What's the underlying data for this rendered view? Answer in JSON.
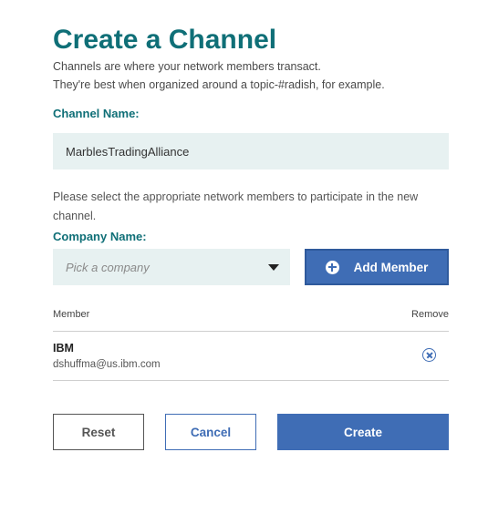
{
  "page": {
    "title": "Create a Channel",
    "subtitle_line1": "Channels are where your network members transact.",
    "subtitle_line2": "They're best when organized around a topic-#radish, for example."
  },
  "channel": {
    "label": "Channel Name:",
    "value": "MarblesTradingAlliance"
  },
  "members_help": "Please select the appropriate network members to participate in the new channel.",
  "company": {
    "label": "Company Name:",
    "placeholder": "Pick a company",
    "add_button_label": "Add Member"
  },
  "members_table": {
    "col_member": "Member",
    "col_remove": "Remove",
    "rows": [
      {
        "name": "IBM",
        "email": "dshuffma@us.ibm.com"
      }
    ]
  },
  "actions": {
    "reset_label": "Reset",
    "cancel_label": "Cancel",
    "create_label": "Create"
  },
  "icons": {
    "add": "plus-circle-icon",
    "remove": "close-circle-icon",
    "dropdown": "caret-down-icon"
  },
  "colors": {
    "heading_teal": "#0f6f77",
    "primary_blue": "#3f6db5",
    "input_bg": "#e7f1f1"
  }
}
